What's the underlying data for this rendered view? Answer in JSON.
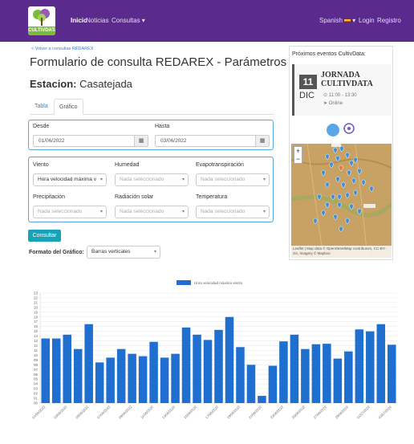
{
  "nav": {
    "logo_text": "CULTIVDATA",
    "links": [
      "Inicio",
      "Noticias",
      "Consultas ▾"
    ],
    "language": "Spanish",
    "language_caret": "▾",
    "login": "Login",
    "register": "Registro"
  },
  "page": {
    "back_link": "< Volver a consultas REDAREX",
    "title": "Formulario de consulta REDAREX - Parámetros",
    "station_label": "Estacion:",
    "station_name": "Casatejada"
  },
  "tabs": [
    "Tabla",
    "Gráfico"
  ],
  "dates": {
    "from_label": "Desde",
    "from_value": "01/06/2022",
    "to_label": "Hasta",
    "to_value": "03/06/2022"
  },
  "params": [
    {
      "label": "Viento",
      "value": "Hora velocidad máxima v",
      "filled": true
    },
    {
      "label": "Humedad",
      "value": "Nada seleccionado",
      "filled": false
    },
    {
      "label": "Evapotranspiración",
      "value": "Nada seleccionado",
      "filled": false
    },
    {
      "label": "Precipitación",
      "value": "Nada seleccionado",
      "filled": false
    },
    {
      "label": "Radiación solar",
      "value": "Nada seleccionado",
      "filled": false
    },
    {
      "label": "Temperatura",
      "value": "Nada seleccionado",
      "filled": false
    }
  ],
  "consult_button": "Consultar",
  "format": {
    "label": "Formato del Gráfico:",
    "value": "Barras verticales"
  },
  "sidebar": {
    "title": "Próximos eventos CultivData:",
    "event": {
      "day": "11",
      "month": "DIC",
      "name_line1": "JORNADA",
      "name_line2": "CULTIVDATA",
      "time": "11:00 - 13:30",
      "place": "Online"
    },
    "map_attribution": "Leaflet | Map data © OpenStreetMap contributors, CC-BY-SA, Imagery © Mapbox"
  },
  "colors": {
    "navbar": "#5a2a8c",
    "accent": "#17a2b8",
    "bar": "#1f6fd1",
    "link": "#3a7fcf"
  },
  "chart_data": {
    "type": "bar",
    "legend": "Hora velocidad máxima viento",
    "categories": [
      "01/06/2022",
      "",
      "03/06/2022",
      "",
      "05/06/2022",
      "",
      "07/06/2022",
      "",
      "09/06/2022",
      "",
      "11/06/2022",
      "",
      "13/06/2022",
      "",
      "15/06/2022",
      "",
      "17/06/2022",
      "",
      "19/06/2022",
      "",
      "21/06/2022",
      "",
      "23/06/2022",
      "",
      "25/06/2022",
      "",
      "27/06/2022",
      "",
      "29/06/2022",
      "",
      "01/07/2022",
      "",
      "03/07/2022",
      ""
    ],
    "values": [
      13.5,
      13.5,
      14.3,
      11.3,
      16.5,
      8.5,
      9.5,
      11.3,
      10.3,
      9.8,
      12.8,
      9.5,
      10.3,
      15.8,
      14.3,
      13.2,
      15.3,
      18,
      11.7,
      8,
      1.5,
      7.8,
      12.9,
      14.3,
      11.3,
      12.3,
      12.4,
      9.3,
      10.8,
      15.4,
      15,
      16.5,
      12.2
    ],
    "y_ticks": [
      "00",
      "01",
      "02",
      "03",
      "04",
      "05",
      "06",
      "07",
      "08",
      "09",
      "10",
      "11",
      "12",
      "13",
      "14",
      "15",
      "16",
      "17",
      "18",
      "19",
      "20",
      "21",
      "22",
      "23"
    ],
    "ylim": [
      0,
      23
    ]
  },
  "icons": {
    "calendar": "calendar-icon",
    "clock": "clock-icon",
    "location": "location-arrow-icon",
    "map_marker": "map-marker-icon"
  }
}
